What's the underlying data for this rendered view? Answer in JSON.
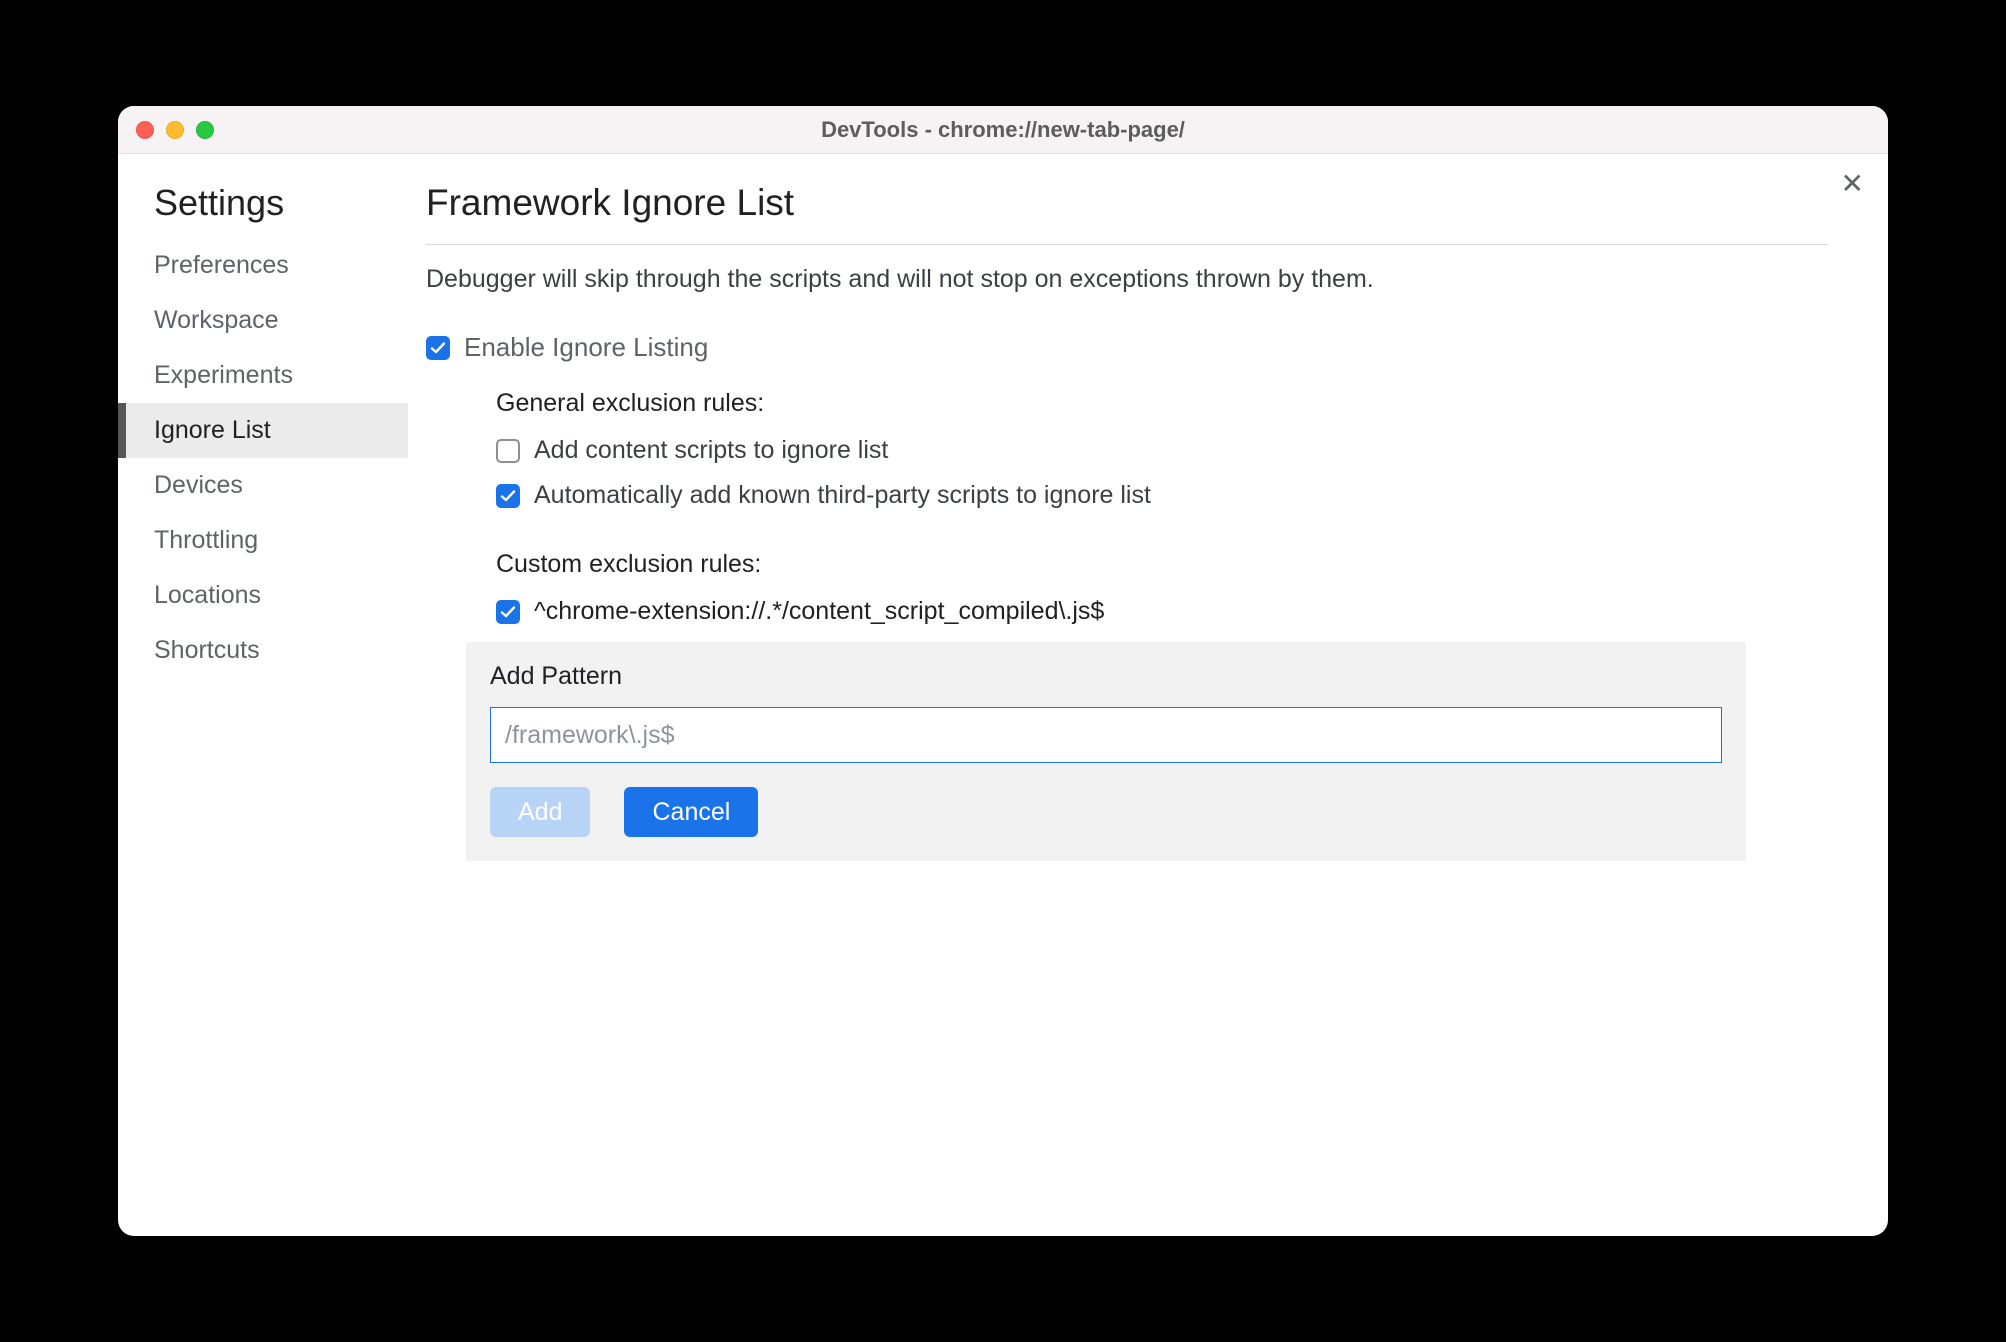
{
  "window": {
    "title": "DevTools - chrome://new-tab-page/"
  },
  "sidebar": {
    "title": "Settings",
    "items": [
      {
        "label": "Preferences",
        "active": false
      },
      {
        "label": "Workspace",
        "active": false
      },
      {
        "label": "Experiments",
        "active": false
      },
      {
        "label": "Ignore List",
        "active": true
      },
      {
        "label": "Devices",
        "active": false
      },
      {
        "label": "Throttling",
        "active": false
      },
      {
        "label": "Locations",
        "active": false
      },
      {
        "label": "Shortcuts",
        "active": false
      }
    ]
  },
  "main": {
    "title": "Framework Ignore List",
    "description": "Debugger will skip through the scripts and will not stop on exceptions thrown by them.",
    "enableLabel": "Enable Ignore Listing",
    "generalLabel": "General exclusion rules:",
    "general": [
      {
        "label": "Add content scripts to ignore list",
        "checked": false
      },
      {
        "label": "Automatically add known third-party scripts to ignore list",
        "checked": true
      }
    ],
    "customLabel": "Custom exclusion rules:",
    "customRules": [
      {
        "pattern": "^chrome-extension://.*/content_script_compiled\\.js$",
        "checked": true
      }
    ],
    "addPattern": {
      "label": "Add Pattern",
      "placeholder": "/framework\\.js$",
      "addLabel": "Add",
      "cancelLabel": "Cancel"
    }
  }
}
